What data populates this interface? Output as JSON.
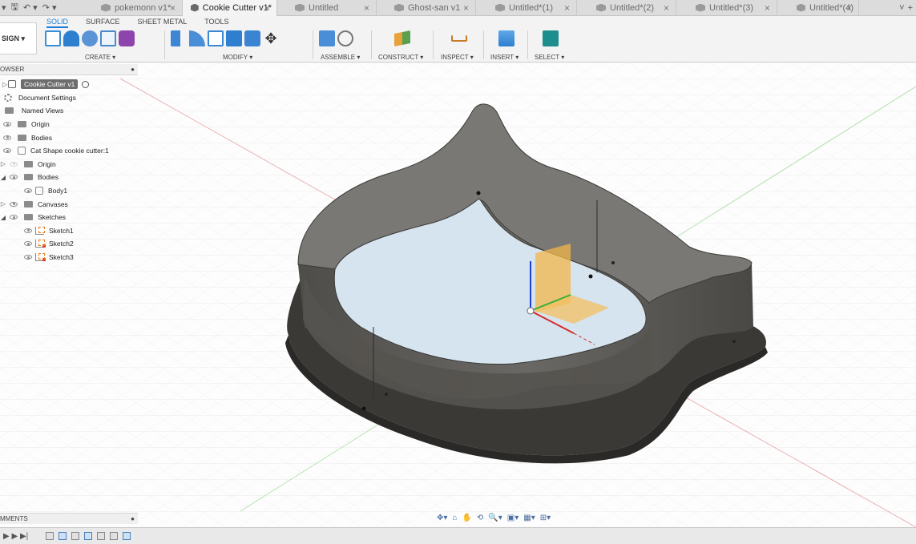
{
  "colors": {
    "accent": "#1a7dd7",
    "model_body": "#5e5c58",
    "model_edge": "#3a3936"
  },
  "quick_access": {
    "undo_label": "↶ ▾",
    "redo_label": "↷ ▾"
  },
  "tabs": [
    {
      "label": "pokemonn v1*",
      "active": false
    },
    {
      "label": "Cookie Cutter v1*",
      "active": true
    },
    {
      "label": "Untitled",
      "active": false
    },
    {
      "label": "Ghost-san v1",
      "active": false
    },
    {
      "label": "Untitled*(1)",
      "active": false
    },
    {
      "label": "Untitled*(2)",
      "active": false
    },
    {
      "label": "Untitled*(3)",
      "active": false
    },
    {
      "label": "Untitled*(4)",
      "active": false
    }
  ],
  "tab_extra": {
    "chevron": "˅",
    "plus": "+"
  },
  "workspace": {
    "label": "SIGN ▾"
  },
  "ribbon_tabs": [
    "SOLID",
    "SURFACE",
    "SHEET METAL",
    "TOOLS"
  ],
  "ribbon_groups": {
    "create": "CREATE ▾",
    "modify": "MODIFY ▾",
    "assemble": "ASSEMBLE ▾",
    "construct": "CONSTRUCT ▾",
    "inspect": "INSPECT ▾",
    "insert": "INSERT ▾",
    "select": "SELECT ▾"
  },
  "browser": {
    "title": "OWSER",
    "pin": "●",
    "root": "Cookie Cutter v1",
    "items": [
      {
        "label": "Document Settings"
      },
      {
        "label": "Named Views"
      },
      {
        "label": "Origin"
      },
      {
        "label": "Bodies"
      },
      {
        "label": "Cat Shape cookie cutter:1"
      },
      {
        "label": "Origin"
      },
      {
        "label": "Bodies"
      },
      {
        "label": "Body1"
      },
      {
        "label": "Canvases"
      },
      {
        "label": "Sketches"
      },
      {
        "label": "Sketch1"
      },
      {
        "label": "Sketch2"
      },
      {
        "label": "Sketch3"
      }
    ]
  },
  "comments": {
    "title": "MMENTS",
    "pin": "●"
  },
  "navbar": [
    "✥▾",
    "⌂",
    "✋",
    "⟲",
    "🔍▾",
    "▣▾",
    "▦▾",
    "⊞▾"
  ],
  "timeline": {
    "controls": "▶ ▶ ▶|"
  }
}
